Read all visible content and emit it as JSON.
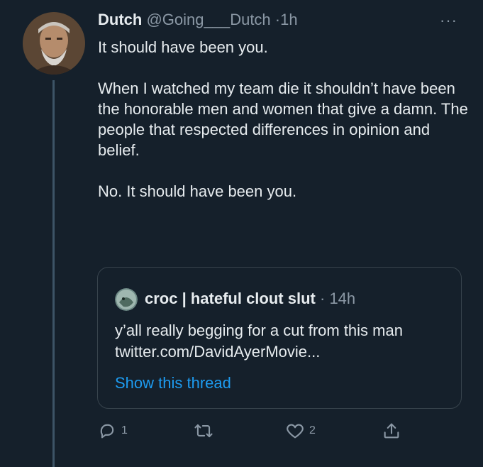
{
  "tweet": {
    "display_name": "Dutch",
    "handle": "@Going___Dutch",
    "separator": "·",
    "time": "1h",
    "more_label": "···",
    "lines": [
      "It should have been you.",
      "When I watched my team die it shouldn’t have been the honorable men and women that give a damn. The people that respected differences in opinion and belief.",
      "No. It should have been you."
    ]
  },
  "quoted": {
    "display_name": "croc | hateful clout slut",
    "separator": "·",
    "time": "14h",
    "text": "y’all really begging for a cut from this man twitter.com/DavidAyerMovie...",
    "show_thread": "Show this thread"
  },
  "actions": {
    "reply_icon": "reply-icon",
    "reply_count": "1",
    "retweet_icon": "retweet-icon",
    "like_icon": "heart-icon",
    "like_count": "2",
    "share_icon": "share-icon"
  },
  "colors": {
    "background": "#15202b",
    "text": "#e7ecef",
    "muted": "#8b98a5",
    "link": "#1d9bf0",
    "border": "#38444d"
  }
}
